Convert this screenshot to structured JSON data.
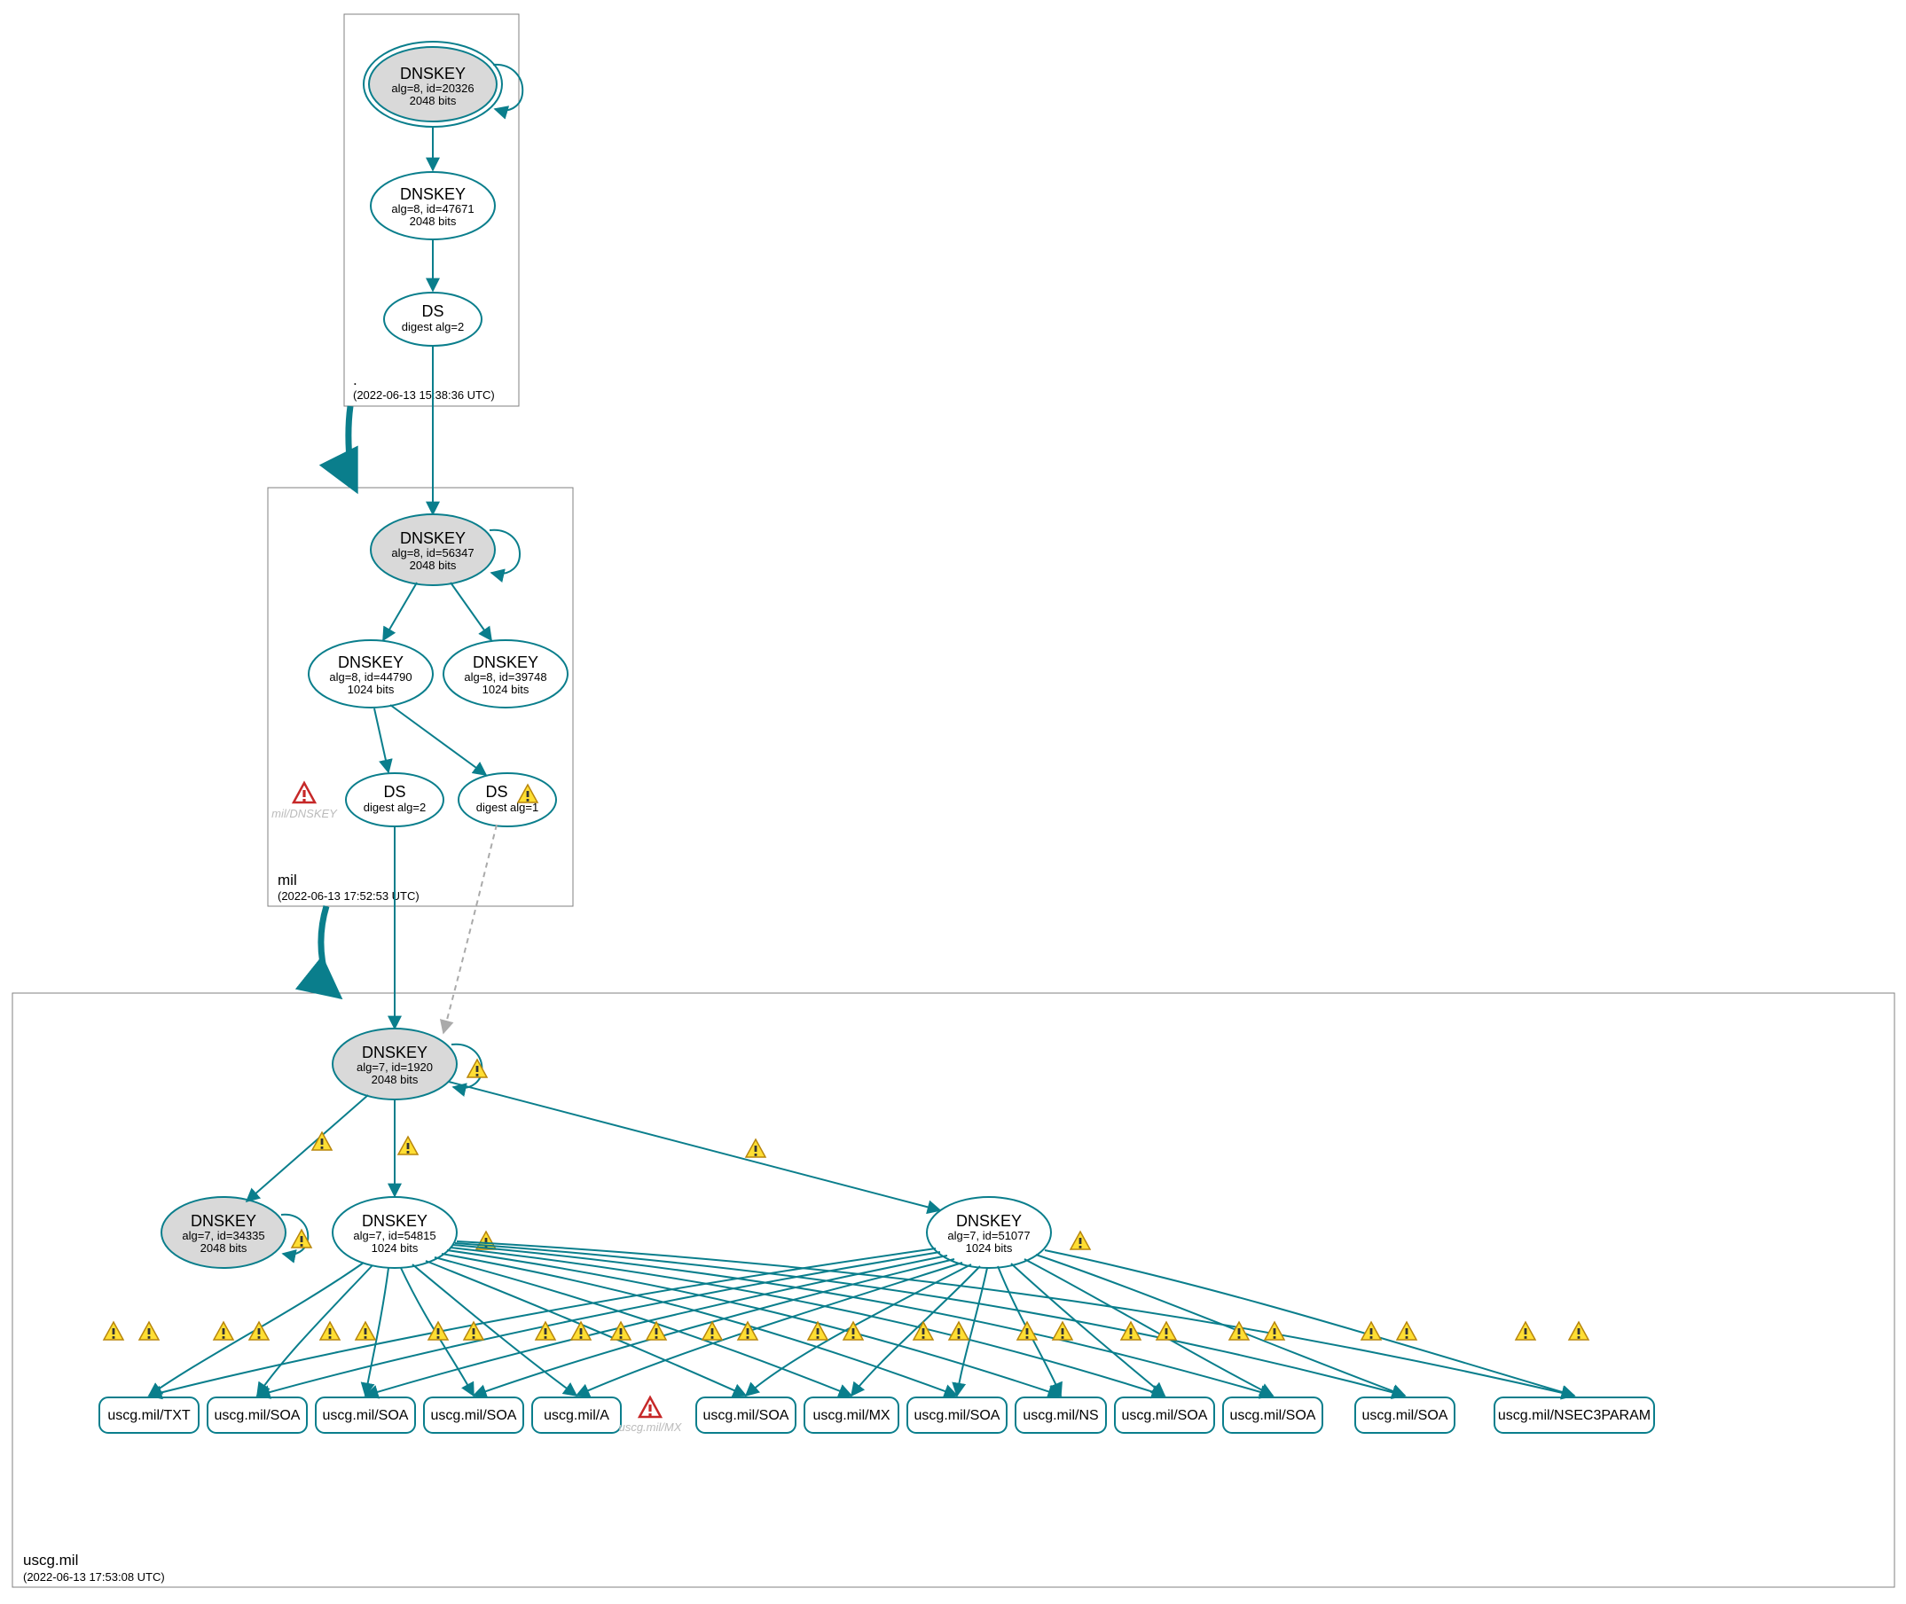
{
  "diagram_type": "DNSSEC authentication chain / DNSViz-style graph",
  "colors": {
    "teal": "#0a7e8c",
    "grey_fill": "#d9d9d9",
    "warning_yellow": "#ffde33",
    "error_red": "#c62828"
  },
  "zones": {
    "root": {
      "name": ".",
      "timestamp": "(2022-06-13 15:38:36 UTC)"
    },
    "mil": {
      "name": "mil",
      "timestamp": "(2022-06-13 17:52:53 UTC)"
    },
    "uscg": {
      "name": "uscg.mil",
      "timestamp": "(2022-06-13 17:53:08 UTC)"
    }
  },
  "nodes": {
    "root_ksk": {
      "t": "DNSKEY",
      "l1": "alg=8, id=20326",
      "l2": "2048 bits"
    },
    "root_zsk": {
      "t": "DNSKEY",
      "l1": "alg=8, id=47671",
      "l2": "2048 bits"
    },
    "root_ds": {
      "t": "DS",
      "l1": "digest alg=2"
    },
    "mil_ksk": {
      "t": "DNSKEY",
      "l1": "alg=8, id=56347",
      "l2": "2048 bits"
    },
    "mil_zsk1": {
      "t": "DNSKEY",
      "l1": "alg=8, id=44790",
      "l2": "1024 bits"
    },
    "mil_zsk2": {
      "t": "DNSKEY",
      "l1": "alg=8, id=39748",
      "l2": "1024 bits"
    },
    "mil_ds1": {
      "t": "DS",
      "l1": "digest alg=2"
    },
    "mil_ds2": {
      "t": "DS",
      "l1": "digest alg=1"
    },
    "mil_err": {
      "t": "mil/DNSKEY"
    },
    "u_ksk": {
      "t": "DNSKEY",
      "l1": "alg=7, id=1920",
      "l2": "2048 bits"
    },
    "u_k2": {
      "t": "DNSKEY",
      "l1": "alg=7, id=34335",
      "l2": "2048 bits"
    },
    "u_z1": {
      "t": "DNSKEY",
      "l1": "alg=7, id=54815",
      "l2": "1024 bits"
    },
    "u_z2": {
      "t": "DNSKEY",
      "l1": "alg=7, id=51077",
      "l2": "1024 bits"
    },
    "rr": {
      "txt": "uscg.mil/TXT",
      "soa1": "uscg.mil/SOA",
      "soa2": "uscg.mil/SOA",
      "soa3": "uscg.mil/SOA",
      "a": "uscg.mil/A",
      "mx_err": "uscg.mil/MX",
      "soa4": "uscg.mil/SOA",
      "mx": "uscg.mil/MX",
      "soa5": "uscg.mil/SOA",
      "ns": "uscg.mil/NS",
      "soa6": "uscg.mil/SOA",
      "soa7": "uscg.mil/SOA",
      "soa8": "uscg.mil/SOA",
      "nsec3": "uscg.mil/NSEC3PARAM"
    }
  }
}
